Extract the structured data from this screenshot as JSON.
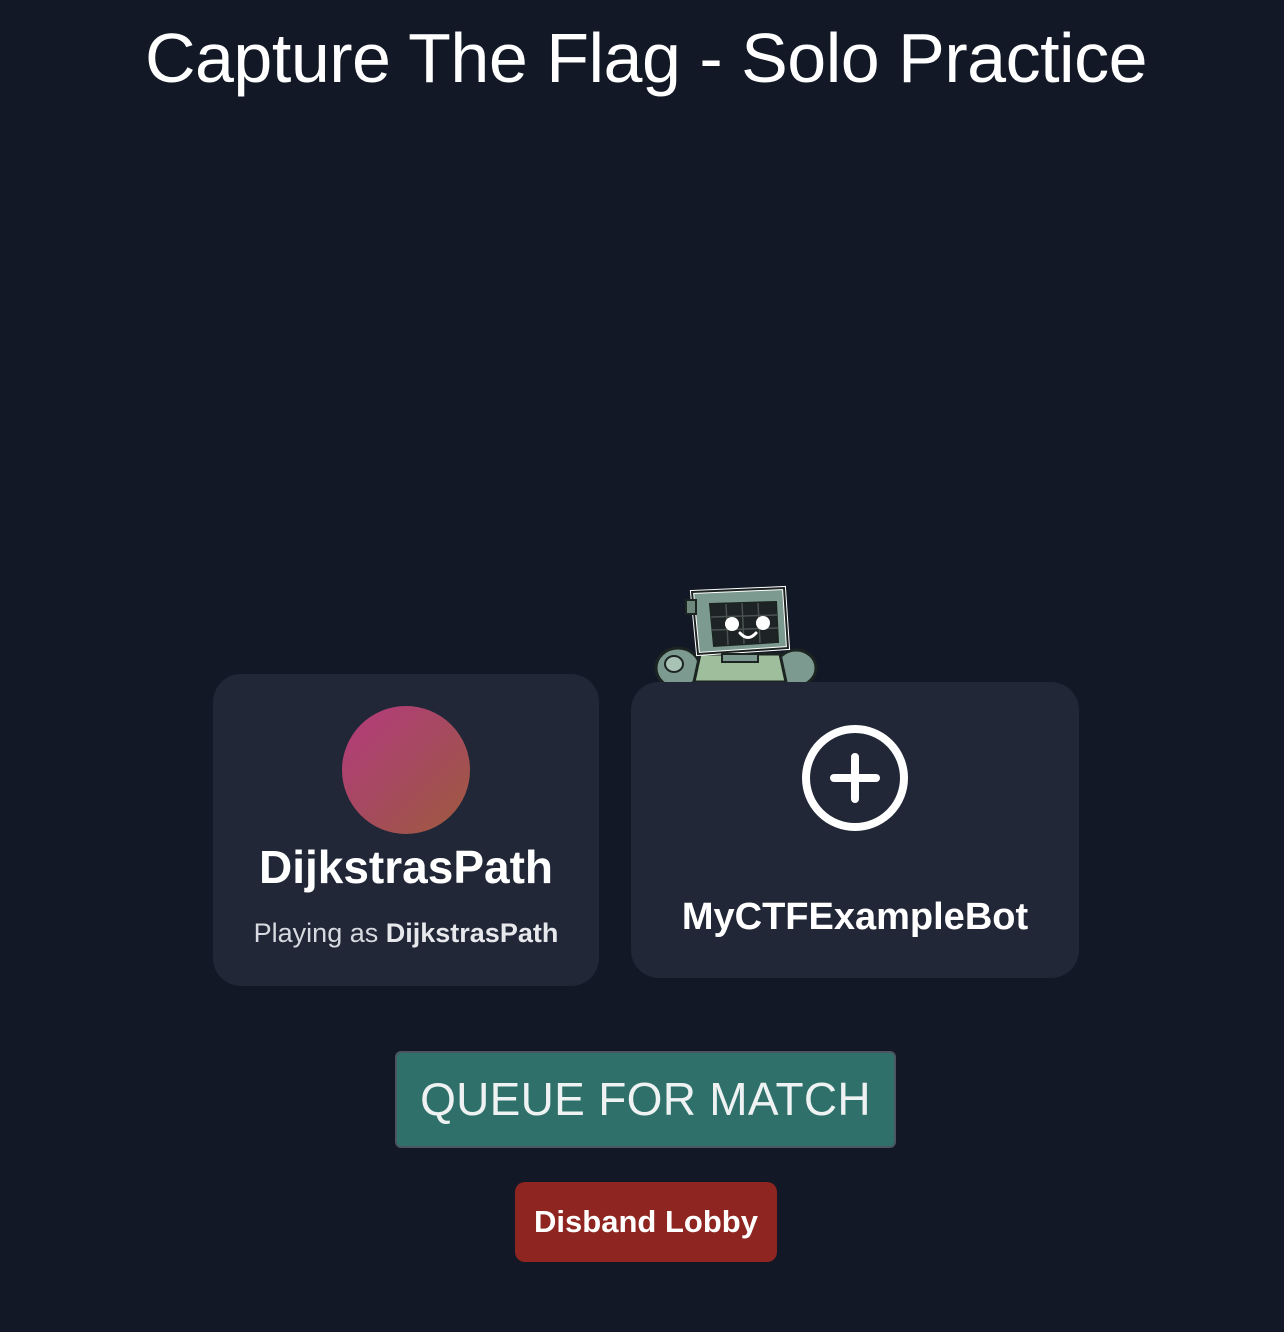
{
  "header": {
    "title": "Capture The Flag - Solo Practice"
  },
  "player_card": {
    "name": "DijkstrasPath",
    "playing_as_prefix": "Playing as",
    "playing_as_name": "DijkstrasPath",
    "avatar_gradient": [
      "#b63a7d",
      "#9f5a3c"
    ]
  },
  "bot_card": {
    "name": "MyCTFExampleBot",
    "icon": "plus-circle-icon",
    "mascot": "robot-mascot-icon"
  },
  "actions": {
    "queue_label": "QUEUE FOR MATCH",
    "disband_label": "Disband Lobby"
  },
  "colors": {
    "background": "#121826",
    "card": "#212737",
    "queue_button": "#2f716a",
    "disband_button": "#8f2520"
  }
}
